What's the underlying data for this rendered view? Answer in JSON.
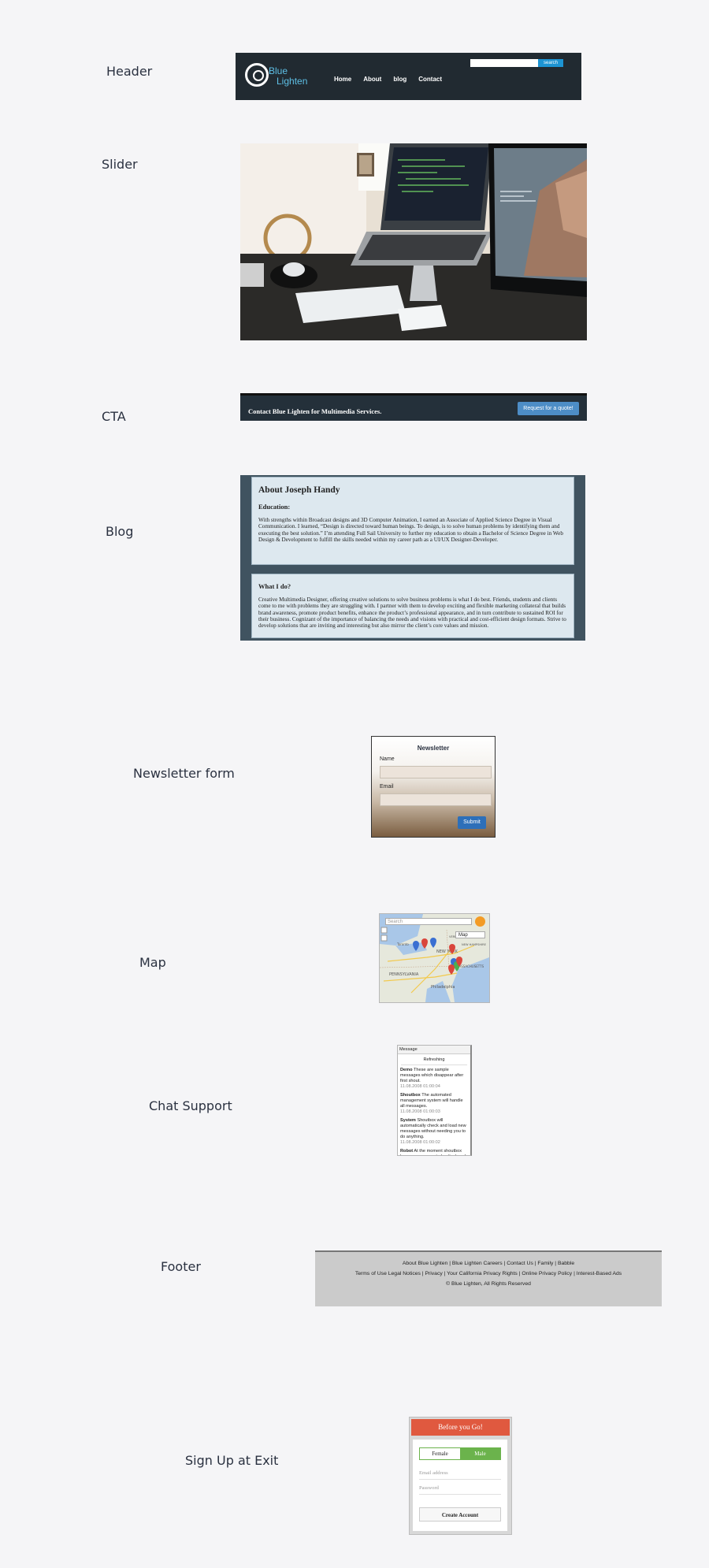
{
  "labels": {
    "header": "Header",
    "slider": "Slider",
    "cta": "CTA",
    "blog": "Blog",
    "newsletter": "Newsletter form",
    "map": "Map",
    "chat": "Chat Support",
    "footer": "Footer",
    "exit": "Sign Up at Exit"
  },
  "header": {
    "brand_line1": "Blue",
    "brand_line2": "Lighten",
    "nav": [
      "Home",
      "About",
      "blog",
      "Contact"
    ],
    "search_button": "search"
  },
  "cta": {
    "text": "Contact Blue Lighten for Multimedia Services.",
    "button": "Request for a quote!"
  },
  "blog": {
    "title": "About Joseph Handy",
    "education_heading": "Education:",
    "education_text": "With strengths within Broadcast designs and 3D Computer Animation, I earned an Associate of Applied Science Degree in Visual Communication. I learned, “Design is directed toward human beings. To design, is to solve human problems by identifying them and executing the best solution.” I’m attending Full Sail University to further my education to obtain a Bachelor of Science Degree in Web Design & Development to fulfill the skills needed within my career path as a UI/UX Designer-Developer.",
    "whatido_heading": "What I do?",
    "whatido_text": "Creative Multimedia Designer, offering creative solutions to solve business problems is what I do best. Friends, students and clients come to me with problems they are struggling with. I partner with them to develop exciting and flexible marketing collateral that builds brand awareness, promote product benefits, enhance the product’s professional appearance, and in turn contribute to sustained ROI for their business. Cognizant of the importance of balancing the needs and visions with practical and cost-efficient design formats. Strive to develop solutions that are inviting and interesting but also mirror the client’s core values and mission."
  },
  "newsletter": {
    "title": "Newsletter",
    "name_label": "Name",
    "email_label": "Email",
    "submit": "Submit"
  },
  "map": {
    "search_placeholder": "Search",
    "map_type": "Map",
    "places": [
      "NEW YORK",
      "MASSACHUSETTS",
      "PENNSYLVANIA",
      "Philadelphia",
      "NEW HAMPSHIRE",
      "VERMONT",
      "Toronto"
    ]
  },
  "chat": {
    "header": "Message",
    "refresh": "Refreshing",
    "messages": [
      {
        "author": "Demo",
        "text": "These are sample messages which disappear after first shout.",
        "time": "11.08.2008 01:00:04"
      },
      {
        "author": "Shoutbox",
        "text": "The automated management system will handle all messages.",
        "time": "11.08.2008 01:00:03"
      },
      {
        "author": "System",
        "text": "Shoutbox will automatically check and load new messages without needing you to do anything.",
        "time": "11.08.2008 01:00:02"
      },
      {
        "author": "Robot",
        "text": "At the moment shoutbox has no messages to be displayed.",
        "time": ""
      }
    ]
  },
  "footer": {
    "line1": "About Blue Lighten | Blue Lighten Careers | Contact Us | Family | Babble",
    "line2": "Terms of Use Legal Notices | Privacy | Your California Privacy Rights | Online Privacy Policy | Interest-Based Ads",
    "line3": "© Blue Lighten, All Rights Reserved"
  },
  "exit": {
    "title": "Before you Go!",
    "female": "Female",
    "male": "Male",
    "email_placeholder": "Email address",
    "password_placeholder": "Password",
    "create": "Create Account"
  }
}
